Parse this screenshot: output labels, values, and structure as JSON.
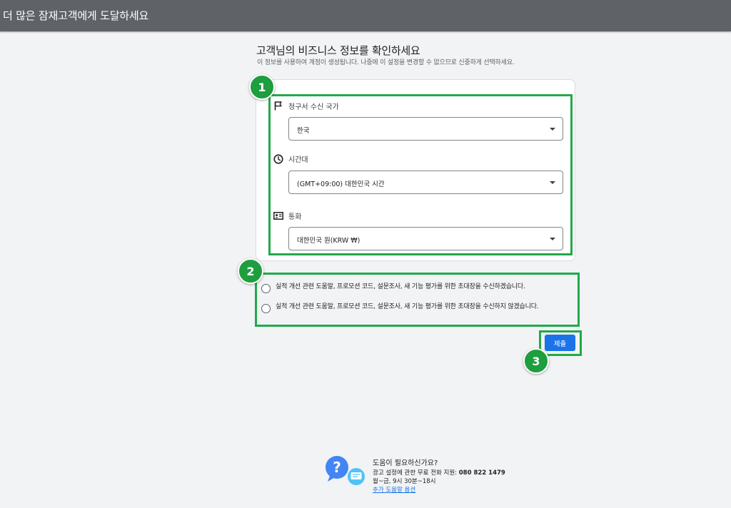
{
  "topbar": {
    "title": "더 많은 잠재고객에게 도달하세요"
  },
  "header": {
    "title": "고객님의 비즈니스 정보를 확인하세요",
    "subtitle": "이 정보를 사용하여 계정이 생성됩니다. 나중에 이 설정을 변경할 수 없으므로 신중하게 선택하세요."
  },
  "fields": {
    "country": {
      "label": "청구서 수신 국가",
      "value": "한국",
      "icon": "flag-icon"
    },
    "timezone": {
      "label": "시간대",
      "value": "(GMT+09:00) 대한민국 시간",
      "icon": "clock-icon"
    },
    "currency": {
      "label": "통화",
      "value": "대한민국 원(KRW ₩)",
      "icon": "currency-icon"
    }
  },
  "consent": {
    "options": [
      {
        "label": "실적 개선 관련 도움말, 프로모션 코드, 설문조사, 새 기능 평가를 위한 초대장을 수신하겠습니다.",
        "selected": false
      },
      {
        "label": "실적 개선 관련 도움말, 프로모션 코드, 설문조사, 새 기능 평가를 위한 초대장을 수신하지 않겠습니다.",
        "selected": false
      }
    ]
  },
  "actions": {
    "submit_label": "제출"
  },
  "annotations": {
    "badge1": "1",
    "badge2": "2",
    "badge3": "3"
  },
  "help": {
    "title": "도움이 필요하신가요?",
    "support_text": "광고 설정에 관한 무료 전화 지원:",
    "phone": "080 822 1479",
    "hours": "월~금, 9시 30분~18시",
    "more_link": "추가 도움말 옵션"
  },
  "colors": {
    "topbar": "#5f6368",
    "highlight": "#22a94a",
    "primary": "#1a73e8"
  }
}
